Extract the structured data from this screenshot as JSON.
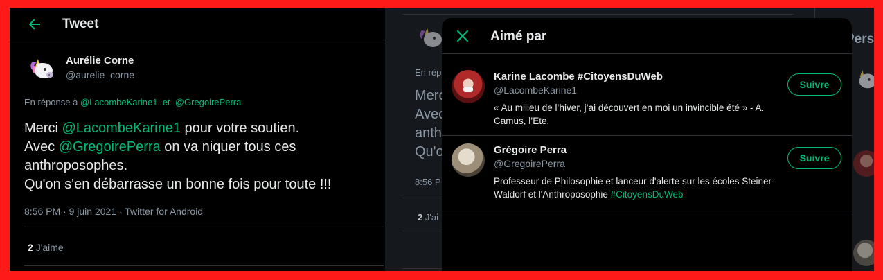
{
  "header": {
    "title": "Tweet"
  },
  "tweet": {
    "author_name": "Aurélie Corne",
    "author_handle": "@aurelie_corne",
    "reply_prefix": "En réponse à",
    "reply_mention_1": "@LacombeKarine1",
    "reply_joiner": "et",
    "reply_mention_2": "@GregoirePerra",
    "line1_a": "Merci ",
    "line1_mention": "@LacombeKarine1",
    "line1_b": " pour votre soutien.",
    "line2_a": "Avec ",
    "line2_mention": "@GregoirePerra",
    "line2_b": " on va niquer tous ces",
    "line3": "anthroposophes.",
    "line4": "Qu'on s'en débarrasse un bonne fois pour toute !!!",
    "meta": "8:56 PM · 9 juin 2021 · Twitter for Android",
    "likes_count": "2",
    "likes_label": "J'aime"
  },
  "background": {
    "reply_fragment": "En rép",
    "text_lines": [
      "Merc",
      "Avec",
      "anth",
      "Qu'o"
    ],
    "time_fragment": "8:56 P",
    "likes_count": "2",
    "likes_fragment": "J'ai",
    "right_title": "Perso"
  },
  "modal": {
    "title": "Aimé par",
    "users": [
      {
        "name": "Karine Lacombe #CitoyensDuWeb",
        "handle": "@LacombeKarine1",
        "follow_label": "Suivre",
        "bio_line1": "« Au milieu de l’hiver, j’ai découvert en moi un invincible été » - A.",
        "bio_line2": "Camus, l’Ete."
      },
      {
        "name": "Grégoire Perra",
        "handle": "@GregoirePerra",
        "follow_label": "Suivre",
        "bio_line1": "Professeur de Philosophie et lanceur d'alerte sur les écoles Steiner-",
        "bio_line2_a": "Waldorf et l'Anthroposophie ",
        "bio_line2_tag": "#CitoyensDuWeb"
      }
    ]
  },
  "colors": {
    "accent": "#00ba7c",
    "background": "#000000",
    "frame_border": "#ff1a1a",
    "muted_text": "#8b98a5"
  }
}
